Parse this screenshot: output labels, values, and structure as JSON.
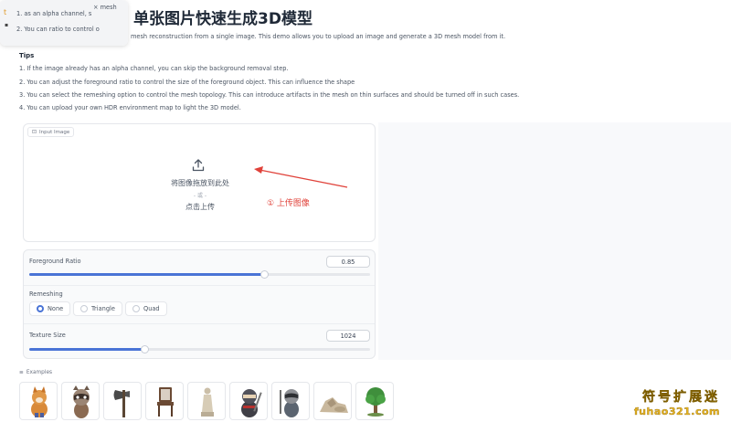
{
  "title": "单张图片快速生成3D模型",
  "intro": "mesh reconstruction from a single image. This demo allows you to upload an image and generate a 3D mesh model from it.",
  "tooltip": {
    "line1": "1. as an alpha channel, s",
    "line2": "2. You can ratio to control o",
    "caption": "× mesh",
    "icon_glyph": "t"
  },
  "tips": {
    "heading": "Tips",
    "items": [
      "1. If the image already has an alpha channel, you can skip the background removal step.",
      "2. You can adjust the foreground ratio to control the size of the foreground object. This can influence the shape",
      "3. You can select the remeshing option to control the mesh topology. This can introduce artifacts in the mesh on thin surfaces and should be turned off in such cases.",
      "4. You can upload your own HDR environment map to light the 3D model."
    ]
  },
  "input_image": {
    "label": "Input Image",
    "drop_text": "将图像拖放到此处",
    "dash": "- 或 -",
    "click_text": "点击上传"
  },
  "annotation": {
    "text": "① 上传图像",
    "color": "#e0423a"
  },
  "settings": {
    "foreground_ratio": {
      "label": "Foreground Ratio",
      "value": "0.85",
      "fraction": 0.69
    },
    "remeshing": {
      "label": "Remeshing",
      "options": [
        "None",
        "Triangle",
        "Quad"
      ],
      "selected": "None"
    },
    "texture_size": {
      "label": "Texture Size",
      "value": "1024",
      "fraction": 0.34
    }
  },
  "examples": {
    "label": "Examples",
    "items": [
      "fox-icon",
      "raccoon-icon",
      "axe-icon",
      "chair-icon",
      "statue-icon",
      "ninja-icon",
      "raccoon-warrior-icon",
      "rocks-icon",
      "tree-icon"
    ]
  },
  "watermark": {
    "line1": "符号扩展迷",
    "line2": "fuhao321.com"
  },
  "colors": {
    "accent": "#4a74d6",
    "annotation": "#e0423a",
    "watermark": "#e8b320"
  }
}
